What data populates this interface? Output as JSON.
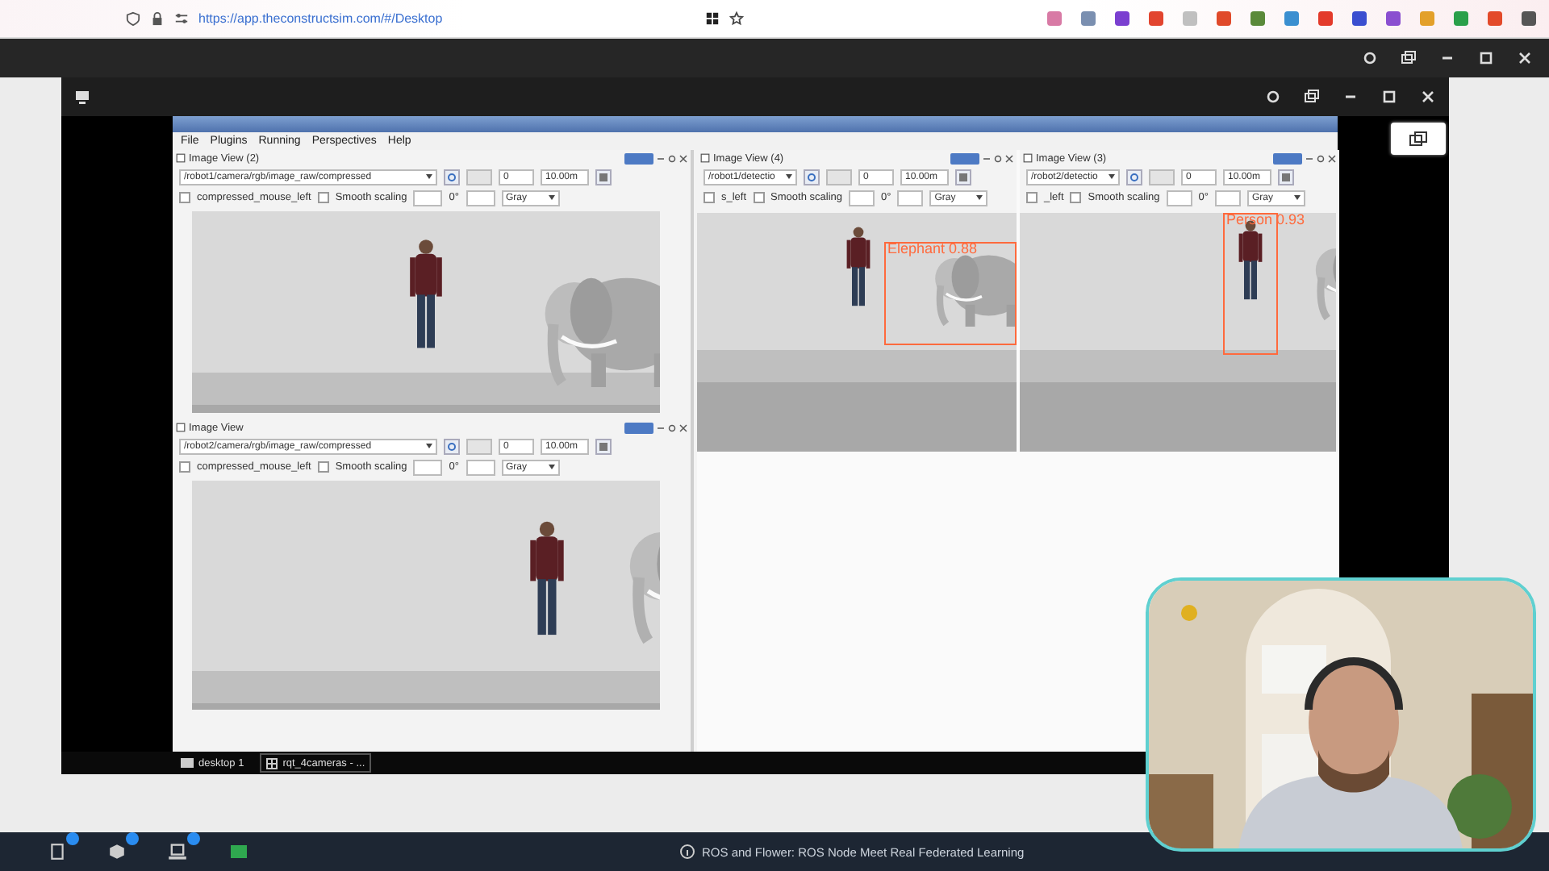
{
  "browser": {
    "url": "https://app.theconstructsim.com/#/Desktop"
  },
  "rqt": {
    "menu": [
      "File",
      "Plugins",
      "Running",
      "Perspectives",
      "Help"
    ],
    "left_views": [
      {
        "title": "Image View (2)",
        "topic": "/robot1/camera/rgb/image_raw/compressed",
        "min": "0",
        "max": "10.00m",
        "mouse_label": "compressed_mouse_left",
        "mouse_checked": false,
        "smooth_label": "Smooth scaling",
        "smooth_checked": false,
        "rotation": "0°",
        "colormap": "Gray"
      },
      {
        "title": "Image View",
        "topic": "/robot2/camera/rgb/image_raw/compressed",
        "min": "0",
        "max": "10.00m",
        "mouse_label": "compressed_mouse_left",
        "mouse_checked": false,
        "smooth_label": "Smooth scaling",
        "smooth_checked": false,
        "rotation": "0°",
        "colormap": "Gray"
      }
    ],
    "right_views": [
      {
        "title": "Image View (4)",
        "topic": "/robot1/detectio",
        "min": "0",
        "max": "10.00m",
        "mouse_label": "s_left",
        "mouse_checked": false,
        "smooth_label": "Smooth scaling",
        "smooth_checked": false,
        "rotation": "0°",
        "colormap": "Gray",
        "detections": [
          {
            "label": "Elephant 0.88"
          }
        ]
      },
      {
        "title": "Image View (3)",
        "topic": "/robot2/detectio",
        "min": "0",
        "max": "10.00m",
        "mouse_label": "_left",
        "mouse_checked": false,
        "smooth_label": "Smooth scaling",
        "smooth_checked": false,
        "rotation": "0°",
        "colormap": "Gray",
        "detections": [
          {
            "label": "Person 0.93"
          }
        ]
      }
    ]
  },
  "taskbar": {
    "items": [
      {
        "kind": "desktop",
        "label": "desktop 1"
      },
      {
        "kind": "window",
        "label": "rqt_4cameras - ..."
      }
    ]
  },
  "bottom_bar": {
    "title": "ROS and Flower: ROS Node Meet Real Federated Learning"
  }
}
